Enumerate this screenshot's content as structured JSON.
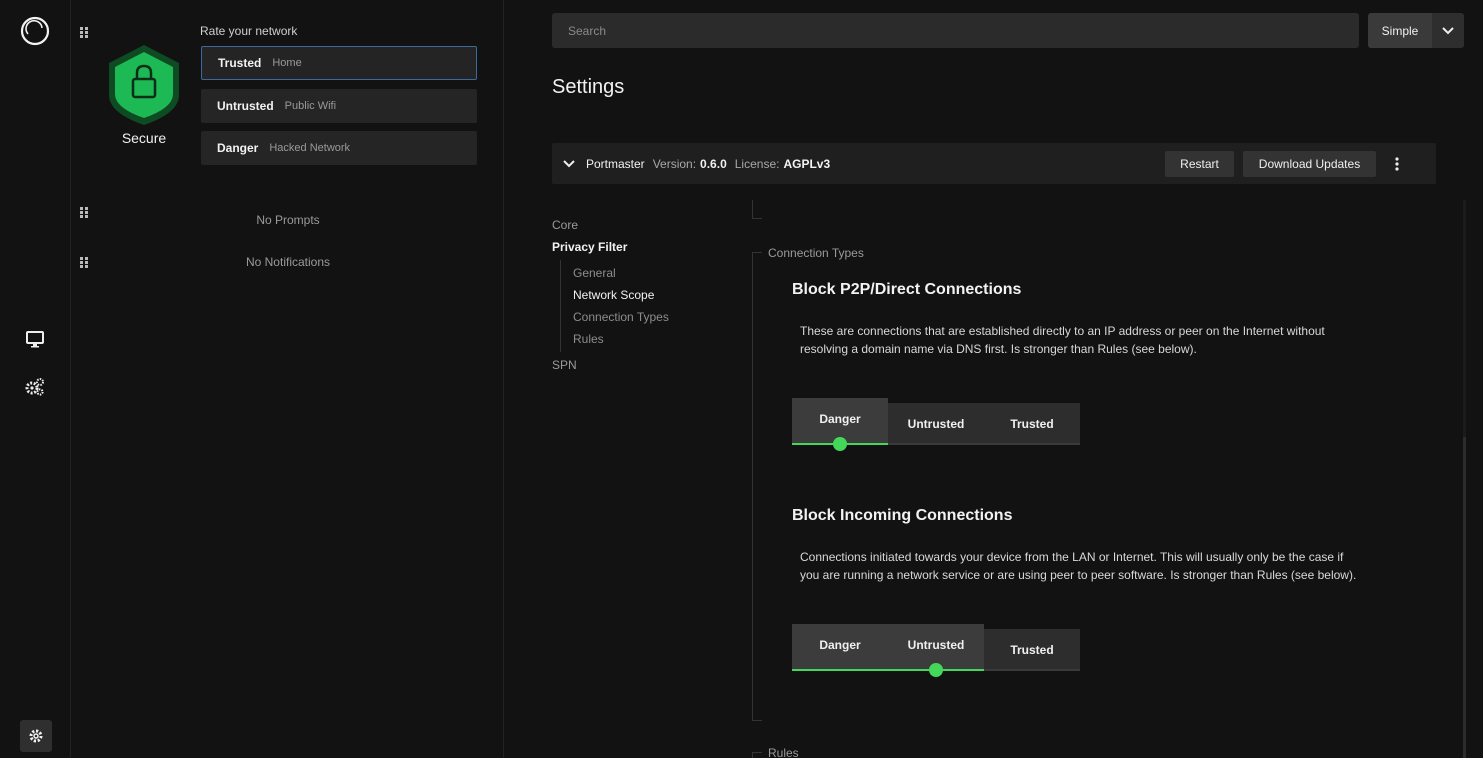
{
  "rail": {
    "icons": [
      "portmaster-logo-icon",
      "monitor-icon",
      "cogs-icon",
      "settings-gear-icon"
    ]
  },
  "side": {
    "status": "Secure",
    "rate_label": "Rate your network",
    "networks": [
      {
        "name": "Trusted",
        "hint": "Home"
      },
      {
        "name": "Untrusted",
        "hint": "Public Wifi"
      },
      {
        "name": "Danger",
        "hint": "Hacked Network"
      }
    ],
    "selected_network": "Trusted",
    "prompts_text": "No Prompts",
    "notifications_text": "No Notifications",
    "accent": "#1db954"
  },
  "search": {
    "placeholder": "Search"
  },
  "mode": {
    "value": "Simple"
  },
  "page_title": "Settings",
  "app_bar": {
    "name": "Portmaster",
    "version_label": "Version:",
    "version": "0.6.0",
    "license_label": "License:",
    "license": "AGPLv3",
    "restart_label": "Restart",
    "download_label": "Download Updates"
  },
  "toc": {
    "core": "Core",
    "privacy": "Privacy Filter",
    "general": "General",
    "network_scope": "Network Scope",
    "connection_types": "Connection Types",
    "rules": "Rules",
    "spn": "SPN"
  },
  "content": {
    "section_connection_types": "Connection Types",
    "section_rules": "Rules",
    "settings": [
      {
        "title": "Block P2P/Direct Connections",
        "desc_line1": "These are connections that are established directly to an IP address or peer on the Internet without",
        "desc_line2": "resolving a domain name via DNS first. Is stronger than Rules (see below).",
        "options": [
          "Danger",
          "Untrusted",
          "Trusted"
        ],
        "selected": "Danger"
      },
      {
        "title": "Block Incoming Connections",
        "desc_line1": "Connections initiated towards your device from the LAN or Internet. This will usually only be the case if",
        "desc_line2": "you are running a network service or are using peer to peer software. Is stronger than Rules (see below).",
        "options": [
          "Danger",
          "Untrusted",
          "Trusted"
        ],
        "selected": "Untrusted"
      }
    ],
    "slider_color": "#43d85a"
  }
}
